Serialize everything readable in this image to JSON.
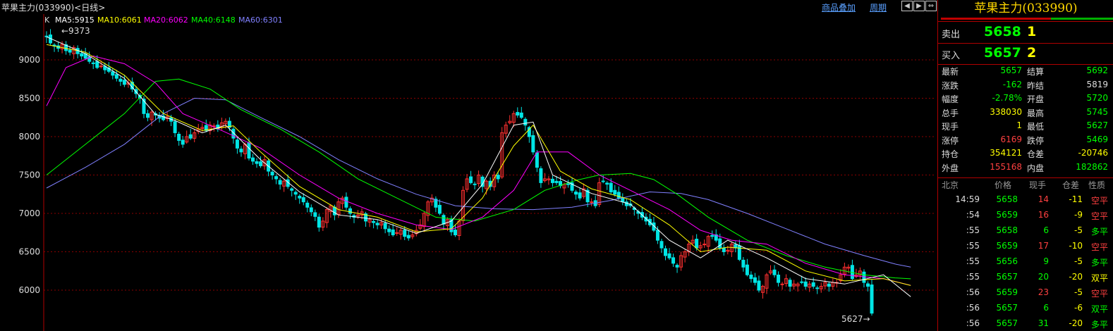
{
  "header": {
    "symbol_title": "苹果主力(033990)<日线>",
    "overlay_link": "商品叠加",
    "period_link": "周期",
    "nav_buttons": [
      "◀",
      "▶",
      "⇔",
      "▣"
    ]
  },
  "legend": {
    "k": "K",
    "ma5": "MA5:5915",
    "ma10": "MA10:6061",
    "ma20": "MA20:6062",
    "ma40": "MA40:6148",
    "ma60": "MA60:6301"
  },
  "colors": {
    "bg": "#000000",
    "up": "#ff3030",
    "down": "#00e5e5",
    "ma5": "#ffffff",
    "ma10": "#ffff00",
    "ma20": "#ff00ff",
    "ma40": "#00ff00",
    "ma60": "#8080ff",
    "grid": "#8b0000"
  },
  "chart_data": {
    "type": "candlestick",
    "ylim": [
      5560,
      9480
    ],
    "yticks": [
      "9000",
      "8500",
      "8000",
      "7500",
      "7000",
      "6500",
      "6000"
    ],
    "annotations": {
      "max_label": "9373",
      "min_label": "5627"
    },
    "closes": [
      9300,
      9220,
      9180,
      9150,
      9200,
      9120,
      9100,
      9160,
      9080,
      9050,
      9020,
      8980,
      8950,
      8900,
      8920,
      8870,
      8850,
      8800,
      8760,
      8720,
      8680,
      8700,
      8620,
      8560,
      8500,
      8300,
      8250,
      8320,
      8280,
      8240,
      8220,
      8260,
      8200,
      8050,
      7950,
      7900,
      8000,
      7980,
      8050,
      8100,
      8120,
      8080,
      8150,
      8140,
      8100,
      8180,
      8200,
      8120,
      7980,
      7850,
      7800,
      7900,
      7720,
      7680,
      7650,
      7620,
      7700,
      7550,
      7500,
      7450,
      7380,
      7420,
      7350,
      7300,
      7250,
      7200,
      7150,
      7080,
      7020,
      6960,
      6820,
      6900,
      7050,
      7100,
      6980,
      7150,
      7200,
      7080,
      7000,
      6950,
      6980,
      7020,
      6900,
      6920,
      6880,
      6850,
      6880,
      6800,
      6760,
      6720,
      6750,
      6780,
      6700,
      6680,
      6720,
      6780,
      6850,
      7000,
      7150,
      7200,
      7080,
      7000,
      6860,
      6920,
      6760,
      6720,
      6900,
      7300,
      7450,
      7400,
      7380,
      7500,
      7350,
      7420,
      7350,
      7500,
      7450,
      8050,
      8150,
      8200,
      8300,
      8280,
      8250,
      8150,
      8000,
      7800,
      7600,
      7400,
      7450,
      7450,
      7400,
      7400,
      7360,
      7380,
      7380,
      7300,
      7250,
      7200,
      7320,
      7150,
      7150,
      7100,
      7400,
      7420,
      7380,
      7280,
      7250,
      7200,
      7150,
      7100,
      7100,
      7050,
      7000,
      6950,
      6900,
      6850,
      6780,
      6650,
      6550,
      6450,
      6420,
      6350,
      6300,
      6450,
      6500,
      6600,
      6650,
      6550,
      6580,
      6600,
      6700,
      6700,
      6650,
      6550,
      6500,
      6520,
      6600,
      6550,
      6400,
      6300,
      6200,
      6150,
      6100,
      6000,
      6050,
      6200,
      6250,
      6200,
      6100,
      6080,
      6150,
      6050,
      6080,
      6080,
      6100,
      6050,
      6080,
      6050,
      6020,
      6050,
      6100,
      6050,
      6100,
      6100,
      6200,
      6300,
      6300,
      6150,
      6200,
      6250,
      6100,
      6050,
      5700
    ],
    "open_close_dir": "derived",
    "ma5": [
      [
        0,
        9300
      ],
      [
        10,
        9080
      ],
      [
        20,
        8760
      ],
      [
        28,
        8290
      ],
      [
        33,
        8210
      ],
      [
        40,
        8050
      ],
      [
        46,
        8150
      ],
      [
        55,
        7700
      ],
      [
        65,
        7280
      ],
      [
        75,
        6980
      ],
      [
        85,
        6920
      ],
      [
        95,
        6740
      ],
      [
        104,
        6900
      ],
      [
        112,
        7380
      ],
      [
        120,
        8150
      ],
      [
        125,
        8190
      ],
      [
        130,
        7500
      ],
      [
        140,
        7260
      ],
      [
        150,
        7120
      ],
      [
        160,
        6650
      ],
      [
        168,
        6420
      ],
      [
        175,
        6650
      ],
      [
        185,
        6420
      ],
      [
        195,
        6150
      ],
      [
        205,
        6080
      ],
      [
        215,
        6200
      ],
      [
        222,
        5915
      ]
    ],
    "ma10": [
      [
        0,
        9200
      ],
      [
        10,
        9100
      ],
      [
        20,
        8800
      ],
      [
        30,
        8300
      ],
      [
        40,
        8080
      ],
      [
        48,
        8140
      ],
      [
        55,
        7800
      ],
      [
        65,
        7350
      ],
      [
        75,
        7050
      ],
      [
        85,
        6950
      ],
      [
        95,
        6760
      ],
      [
        104,
        6800
      ],
      [
        112,
        7200
      ],
      [
        120,
        7880
      ],
      [
        125,
        8150
      ],
      [
        132,
        7550
      ],
      [
        140,
        7320
      ],
      [
        150,
        7180
      ],
      [
        160,
        6850
      ],
      [
        168,
        6500
      ],
      [
        175,
        6560
      ],
      [
        185,
        6520
      ],
      [
        195,
        6250
      ],
      [
        205,
        6120
      ],
      [
        215,
        6150
      ],
      [
        222,
        6061
      ]
    ],
    "ma20": [
      [
        0,
        8400
      ],
      [
        5,
        8900
      ],
      [
        12,
        9050
      ],
      [
        20,
        8950
      ],
      [
        28,
        8700
      ],
      [
        35,
        8300
      ],
      [
        45,
        8080
      ],
      [
        55,
        7850
      ],
      [
        65,
        7500
      ],
      [
        75,
        7200
      ],
      [
        85,
        7000
      ],
      [
        95,
        6850
      ],
      [
        104,
        6790
      ],
      [
        112,
        6950
      ],
      [
        120,
        7300
      ],
      [
        126,
        7800
      ],
      [
        134,
        7800
      ],
      [
        142,
        7500
      ],
      [
        150,
        7300
      ],
      [
        160,
        7050
      ],
      [
        168,
        6780
      ],
      [
        176,
        6650
      ],
      [
        185,
        6600
      ],
      [
        195,
        6350
      ],
      [
        205,
        6200
      ],
      [
        215,
        6150
      ],
      [
        222,
        6062
      ]
    ],
    "ma40": [
      [
        0,
        7500
      ],
      [
        10,
        7900
      ],
      [
        20,
        8300
      ],
      [
        28,
        8720
      ],
      [
        34,
        8750
      ],
      [
        42,
        8620
      ],
      [
        50,
        8350
      ],
      [
        60,
        8100
      ],
      [
        70,
        7800
      ],
      [
        80,
        7450
      ],
      [
        90,
        7200
      ],
      [
        100,
        6950
      ],
      [
        110,
        6900
      ],
      [
        120,
        7050
      ],
      [
        128,
        7300
      ],
      [
        136,
        7430
      ],
      [
        142,
        7500
      ],
      [
        150,
        7520
      ],
      [
        156,
        7440
      ],
      [
        162,
        7250
      ],
      [
        170,
        6950
      ],
      [
        180,
        6650
      ],
      [
        190,
        6450
      ],
      [
        200,
        6300
      ],
      [
        210,
        6200
      ],
      [
        218,
        6160
      ],
      [
        222,
        6148
      ]
    ],
    "ma60": [
      [
        0,
        7330
      ],
      [
        10,
        7600
      ],
      [
        20,
        7900
      ],
      [
        30,
        8300
      ],
      [
        38,
        8500
      ],
      [
        46,
        8480
      ],
      [
        55,
        8250
      ],
      [
        65,
        8000
      ],
      [
        75,
        7700
      ],
      [
        85,
        7450
      ],
      [
        95,
        7250
      ],
      [
        105,
        7100
      ],
      [
        115,
        7060
      ],
      [
        125,
        7050
      ],
      [
        135,
        7080
      ],
      [
        145,
        7170
      ],
      [
        155,
        7280
      ],
      [
        163,
        7260
      ],
      [
        170,
        7180
      ],
      [
        180,
        7000
      ],
      [
        190,
        6800
      ],
      [
        200,
        6600
      ],
      [
        210,
        6450
      ],
      [
        218,
        6340
      ],
      [
        222,
        6301
      ]
    ]
  },
  "panel": {
    "title": "苹果主力(033990)",
    "sell_label": "卖出",
    "sell_price": "5658",
    "sell_vol": "1",
    "buy_label": "买入",
    "buy_price": "5657",
    "buy_vol": "2",
    "stats": [
      {
        "l1": "最新",
        "v1": "5657",
        "c1": "dn",
        "l2": "结算",
        "v2": "5692",
        "c2": "dn"
      },
      {
        "l1": "涨跌",
        "v1": "-162",
        "c1": "dn",
        "l2": "昨结",
        "v2": "5819",
        "c2": "wh"
      },
      {
        "l1": "幅度",
        "v1": "-2.78%",
        "c1": "dn",
        "l2": "开盘",
        "v2": "5720",
        "c2": "dn"
      },
      {
        "l1": "总手",
        "v1": "338030",
        "c1": "yl",
        "l2": "最高",
        "v2": "5745",
        "c2": "dn"
      },
      {
        "l1": "现手",
        "v1": "1",
        "c1": "yl",
        "l2": "最低",
        "v2": "5627",
        "c2": "dn"
      },
      {
        "l1": "涨停",
        "v1": "6169",
        "c1": "up",
        "l2": "跌停",
        "v2": "5469",
        "c2": "dn"
      },
      {
        "l1": "持仓",
        "v1": "354121",
        "c1": "yl",
        "l2": "仓差",
        "v2": "-20746",
        "c2": "yl"
      },
      {
        "l1": "外盘",
        "v1": "155168",
        "c1": "up",
        "l2": "内盘",
        "v2": "182862",
        "c2": "dn"
      }
    ],
    "tick_header": [
      "北京",
      "价格",
      "现手",
      "仓差",
      "性质"
    ],
    "ticks": [
      {
        "time": "14:59",
        "price": "5658",
        "pc": "dn",
        "vol": "14",
        "vc": "up",
        "oi": "-11",
        "oc": "yl",
        "nat": "空平",
        "nc": "up"
      },
      {
        "time": ":54",
        "price": "5659",
        "pc": "dn",
        "vol": "16",
        "vc": "up",
        "oi": "-9",
        "oc": "yl",
        "nat": "空平",
        "nc": "up"
      },
      {
        "time": ":55",
        "price": "5658",
        "pc": "dn",
        "vol": "6",
        "vc": "dn",
        "oi": "-5",
        "oc": "yl",
        "nat": "多平",
        "nc": "dn"
      },
      {
        "time": ":55",
        "price": "5659",
        "pc": "dn",
        "vol": "17",
        "vc": "up",
        "oi": "-10",
        "oc": "yl",
        "nat": "空平",
        "nc": "up"
      },
      {
        "time": ":55",
        "price": "5656",
        "pc": "dn",
        "vol": "9",
        "vc": "dn",
        "oi": "-5",
        "oc": "yl",
        "nat": "多平",
        "nc": "dn"
      },
      {
        "time": ":55",
        "price": "5657",
        "pc": "dn",
        "vol": "20",
        "vc": "dn",
        "oi": "-20",
        "oc": "yl",
        "nat": "双平",
        "nc": "yl"
      },
      {
        "time": ":56",
        "price": "5659",
        "pc": "dn",
        "vol": "23",
        "vc": "up",
        "oi": "-5",
        "oc": "yl",
        "nat": "空平",
        "nc": "up"
      },
      {
        "time": ":56",
        "price": "5657",
        "pc": "dn",
        "vol": "6",
        "vc": "dn",
        "oi": "-6",
        "oc": "yl",
        "nat": "双平",
        "nc": "dn"
      },
      {
        "time": ":56",
        "price": "5657",
        "pc": "dn",
        "vol": "31",
        "vc": "dn",
        "oi": "-20",
        "oc": "yl",
        "nat": "多平",
        "nc": "dn"
      }
    ]
  }
}
